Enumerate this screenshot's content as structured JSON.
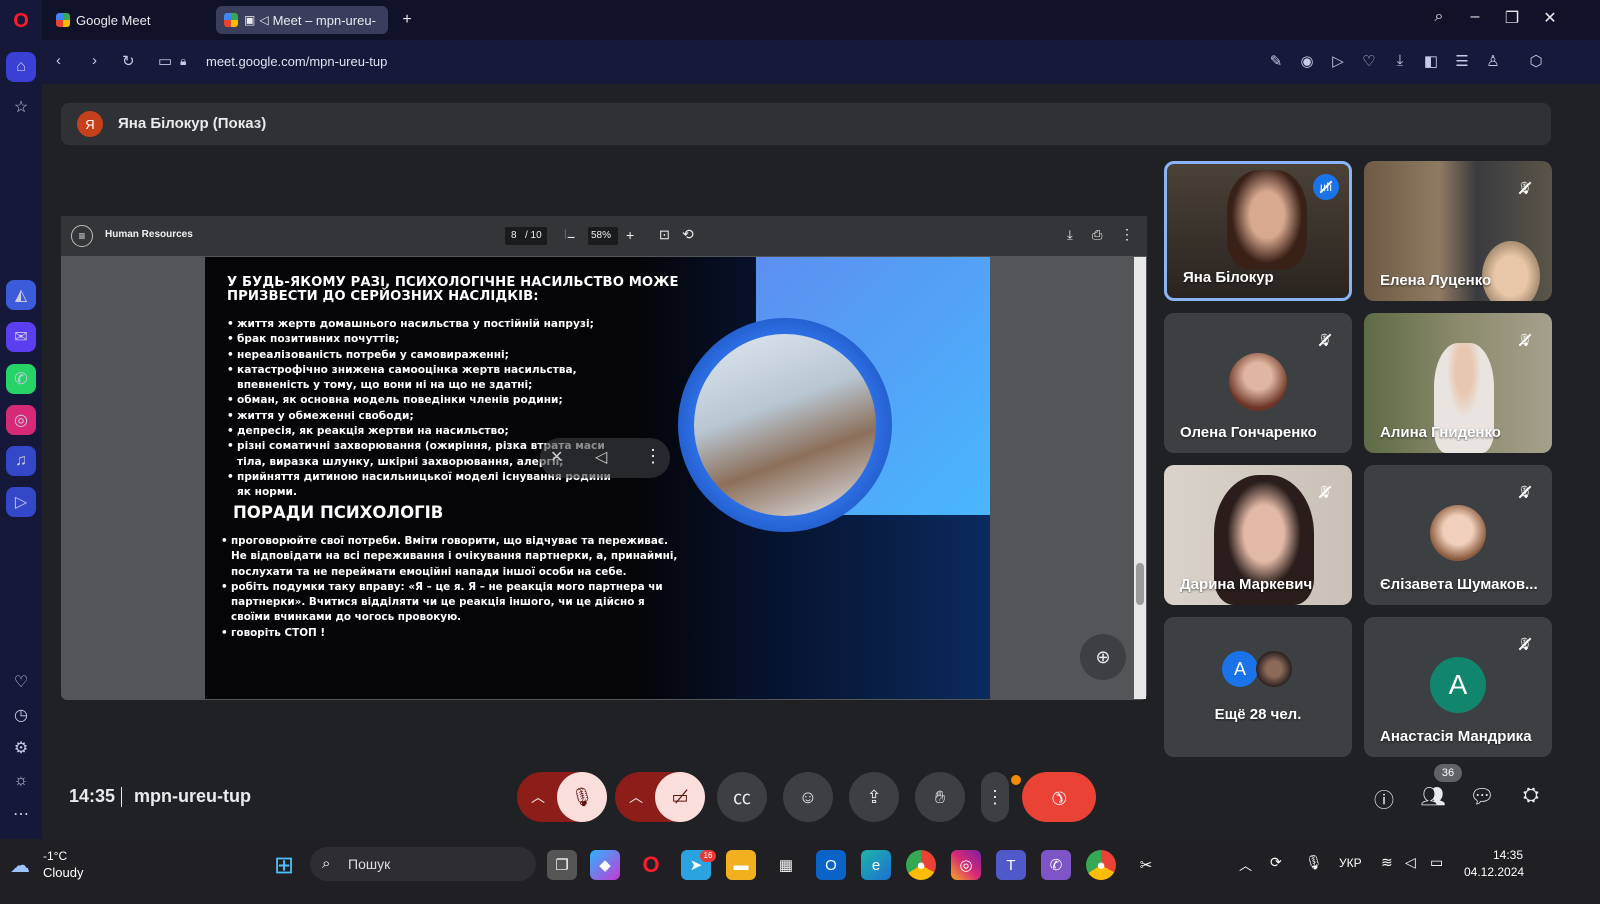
{
  "browser": {
    "tabs": [
      {
        "label": "Google Meet"
      },
      {
        "label": "Meet – mpn-ureu-"
      }
    ],
    "new_tab": "+",
    "url": "meet.google.com/mpn-ureu-tup"
  },
  "meet": {
    "presenter_initial": "Я",
    "presenter_label": "Яна Білокур (Показ)",
    "time": "14:35",
    "meeting_code": "mpn-ureu-tup",
    "participants_count": "36",
    "accent_end_call": "#ea4335"
  },
  "pdf": {
    "title": "Human Resources",
    "page_current": "8",
    "page_total": "/ 10",
    "zoom": "58%"
  },
  "slide": {
    "heading_line1": "У БУДЬ-ЯКОМУ РАЗІ, ПСИХОЛОГІЧНЕ НАСИЛЬСТВО МОЖЕ",
    "heading_line2": "ПРИЗВЕСТИ ДО СЕРЙОЗНИХ НАСЛІДКІВ:",
    "bullets": [
      "життя жертв домашнього насильства у постійній напрузі;",
      "брак позитивних почуттів;",
      "нереалізованість потреби у самовираженні;",
      "катастрофічно знижена самооцінка жертв насильства, впевненість у тому, що вони ні на що не здатні;",
      "обман, як основна модель поведінки членів родини;",
      "життя у обмеженні свободи;",
      "депресія, як реакція жертви на насильство;",
      "різні соматичні захворювання (ожиріння, різка втрата маси тіла, виразка шлунку, шкірні захворювання, алергії;",
      "прийняття дитиною насильницької моделі існування родини як норми."
    ],
    "advice_heading": "ПОРАДИ ПСИХОЛОГІВ",
    "advice": [
      "проговорюйте свої потреби. Вміти говорити, що відчуває та переживає. Не відповідати на всі переживання і очікування партнерки, а, принаймні, послухати та не переймати емоційні напади іншої особи на себе.",
      "робіть подумки таку вправу: «Я – це я. Я – не реакція мого партнера чи партнерки». Вчитися відділяти чи це реакція іншого, чи це дійсно я своїми вчинками до чогось провокую.",
      "говоріть СТОП !"
    ]
  },
  "participants": [
    {
      "name": "Яна Білокур"
    },
    {
      "name": "Елена Луценко"
    },
    {
      "name": "Олена Гончаренко"
    },
    {
      "name": "Алина Гниденко"
    },
    {
      "name": "Дарина Маркевич"
    },
    {
      "name": "Єлізавета Шумаков..."
    },
    {
      "name": "Ещё 28 чел.",
      "initial": "A"
    },
    {
      "name": "Анастасія Мандрика",
      "initial": "A"
    }
  ],
  "taskbar": {
    "weather_temp": "-1°C",
    "weather_desc": "Cloudy",
    "search_placeholder": "Пошук",
    "language": "УКР",
    "clock_time": "14:35",
    "clock_date": "04.12.2024",
    "telegram_badge": "16"
  }
}
